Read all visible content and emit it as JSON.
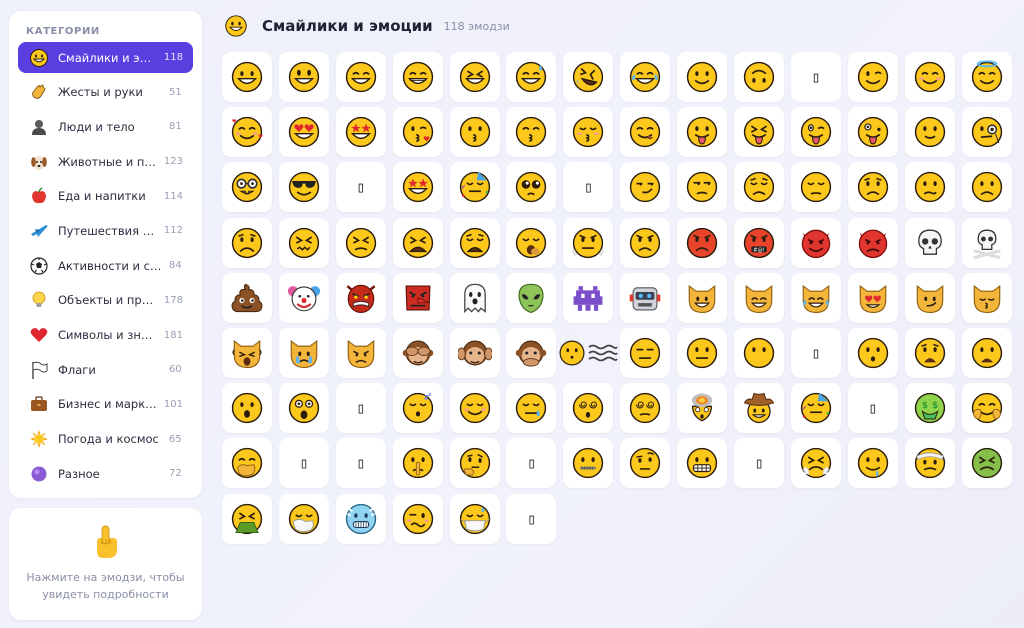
{
  "sidebar": {
    "title": "КАТЕГОРИИ",
    "categories": [
      {
        "label": "Смайлики и эмоции",
        "count": "118",
        "icon": "grinning-face-icon"
      },
      {
        "label": "Жесты и руки",
        "count": "51",
        "icon": "waving-hand-icon"
      },
      {
        "label": "Люди и тело",
        "count": "81",
        "icon": "person-icon"
      },
      {
        "label": "Животные и природа",
        "count": "123",
        "icon": "dog-face-icon"
      },
      {
        "label": "Еда и напитки",
        "count": "114",
        "icon": "apple-icon"
      },
      {
        "label": "Путешествия и места",
        "count": "112",
        "icon": "airplane-icon"
      },
      {
        "label": "Активности и спорт",
        "count": "84",
        "icon": "soccer-ball-icon"
      },
      {
        "label": "Объекты и предметы",
        "count": "178",
        "icon": "light-bulb-icon"
      },
      {
        "label": "Символы и знаки",
        "count": "181",
        "icon": "red-heart-icon"
      },
      {
        "label": "Флаги",
        "count": "60",
        "icon": "white-flag-icon"
      },
      {
        "label": "Бизнес и маркетинг",
        "count": "101",
        "icon": "briefcase-icon"
      },
      {
        "label": "Погода и космос",
        "count": "65",
        "icon": "sun-icon"
      },
      {
        "label": "Разное",
        "count": "72",
        "icon": "purple-circle-icon"
      }
    ]
  },
  "hint": {
    "icon": "pointing-finger-icon",
    "text": "Нажмите на эмодзи, чтобы увидеть подробности"
  },
  "header": {
    "icon": "grinning-face-icon",
    "title": "Смайлики и эмоции",
    "count": "118 эмодзи"
  },
  "emojis": [
    "grinning-face",
    "grinning-face-big-eyes",
    "grinning-face-smiling-eyes",
    "beaming-face",
    "squinting-face",
    "grinning-sweat",
    "rofl",
    "tears-of-joy",
    "slightly-smiling",
    "upside-down",
    "missing",
    "winking",
    "smiling-eyes",
    "halo",
    "smiling-hearts",
    "heart-eyes",
    "star-struck",
    "face-blowing-kiss",
    "kissing",
    "kissing-smiling-eyes",
    "kissing-closed-eyes",
    "yum",
    "tongue",
    "squinting-tongue",
    "winking-tongue",
    "zany",
    "smiling-face",
    "monocle",
    "nerd",
    "sunglasses",
    "missing",
    "star-struck",
    "partying",
    "pleading",
    "missing",
    "smirking",
    "unamused",
    "disappointed",
    "pensive",
    "worried",
    "confused",
    "slightly-frowning",
    "frowning",
    "confounded",
    "persevering",
    "tired",
    "weary",
    "yawning",
    "steaming",
    "angry",
    "pouting",
    "cursing",
    "smiling-devil",
    "angry-devil",
    "skull",
    "skull-crossbones",
    "poop",
    "clown",
    "ogre",
    "goblin",
    "ghost",
    "alien",
    "alien-monster",
    "robot",
    "grinning-cat",
    "grinning-cat-eyes",
    "cat-tears-of-joy",
    "heart-eyes-cat",
    "wry-cat",
    "kissing-cat",
    "weary-cat",
    "crying-cat",
    "pouting-cat",
    "see-no-evil",
    "hear-no-evil",
    "speak-no-evil",
    "face-in-clouds",
    "expressionless",
    "neutral",
    "no-mouth",
    "missing",
    "hushed",
    "anguished",
    "frowning-open-mouth",
    "open-mouth",
    "astonished",
    "missing",
    "sleeping",
    "relieved",
    "sleepy",
    "dizzy-eyes",
    "face-spiral",
    "exploding",
    "cowboy",
    "partying",
    "missing",
    "money-mouth",
    "hugging",
    "hand-over-mouth",
    "missing",
    "missing",
    "shushing",
    "thinking",
    "missing",
    "zipper-mouth",
    "raised-eyebrow",
    "grimacing",
    "missing",
    "face-with-head-bandage",
    "drooling",
    "bandaged",
    "nauseated",
    "vomiting",
    "sneezing",
    "cold",
    "woozy",
    "face-with-mask",
    "missing"
  ]
}
